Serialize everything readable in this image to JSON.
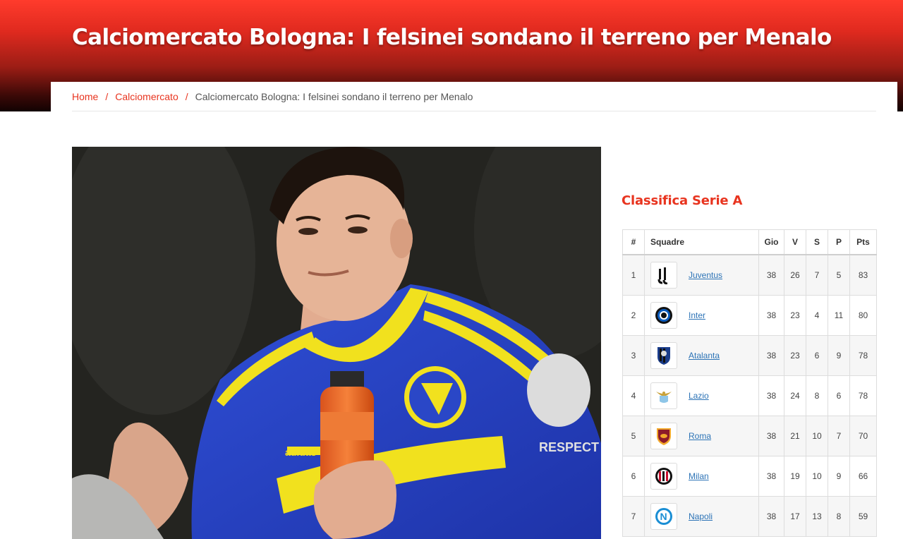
{
  "article": {
    "title": "Calciomercato Bologna: I felsinei sondano il terreno per Menalo"
  },
  "breadcrumb": {
    "home": "Home",
    "separator": "/",
    "category": "Calciomercato",
    "current": "Calciomercato Bologna: I felsinei sondano il terreno per Menalo"
  },
  "photo": {
    "jersey_brand": "adidas",
    "sleeve_text": "RESPECT"
  },
  "sidebar": {
    "title": "Classifica Serie A",
    "columns": [
      "#",
      "Squadre",
      "Gio",
      "V",
      "S",
      "P",
      "Pts"
    ],
    "rows": [
      {
        "pos": "1",
        "team": "Juventus",
        "logo": "juventus-logo",
        "gio": "38",
        "v": "26",
        "s": "7",
        "p": "5",
        "pts": "83"
      },
      {
        "pos": "2",
        "team": "Inter",
        "logo": "inter-logo",
        "gio": "38",
        "v": "23",
        "s": "4",
        "p": "11",
        "pts": "80"
      },
      {
        "pos": "3",
        "team": "Atalanta",
        "logo": "atalanta-logo",
        "gio": "38",
        "v": "23",
        "s": "6",
        "p": "9",
        "pts": "78"
      },
      {
        "pos": "4",
        "team": "Lazio",
        "logo": "lazio-logo",
        "gio": "38",
        "v": "24",
        "s": "8",
        "p": "6",
        "pts": "78"
      },
      {
        "pos": "5",
        "team": "Roma",
        "logo": "roma-logo",
        "gio": "38",
        "v": "21",
        "s": "10",
        "p": "7",
        "pts": "70"
      },
      {
        "pos": "6",
        "team": "Milan",
        "logo": "milan-logo",
        "gio": "38",
        "v": "19",
        "s": "10",
        "p": "9",
        "pts": "66"
      },
      {
        "pos": "7",
        "team": "Napoli",
        "logo": "napoli-logo",
        "gio": "38",
        "v": "17",
        "s": "13",
        "p": "8",
        "pts": "59"
      }
    ]
  },
  "colors": {
    "accent": "#e8341f",
    "link": "#2c73b6",
    "header_top": "#ff3b2c",
    "header_bottom": "#120202"
  }
}
